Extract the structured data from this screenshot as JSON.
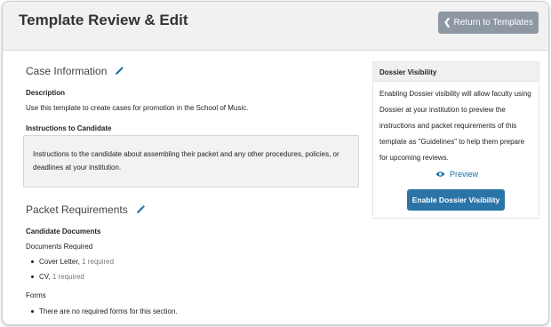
{
  "header": {
    "title": "Template Review & Edit",
    "return_label": "Return to Templates"
  },
  "case_info": {
    "title": "Case Information",
    "description_label": "Description",
    "description_text": "Use this template to create cases for promotion in the School of Music.",
    "instructions_label": "Instructions to Candidate",
    "instructions_text": "Instructions to the candidate about assembling their packet and any other procedures, policies, or deadlines at your institution."
  },
  "packet": {
    "title": "Packet Requirements",
    "candidate_docs_label": "Candidate Documents",
    "docs_required_label": "Documents Required",
    "documents": [
      {
        "name": "Cover Letter,",
        "requirement": "1 required"
      },
      {
        "name": "CV,",
        "requirement": "1 required"
      }
    ],
    "forms_label": "Forms",
    "forms_empty": "There are no required forms for this section."
  },
  "sidebar": {
    "title": "Dossier Visibility",
    "body": "Enabling Dossier visibility will allow faculty using Dossier at your institution to preview the instructions and packet requirements of this template as \"Guidelines\" to help them prepare for upcoming reviews.",
    "preview_label": "Preview",
    "enable_label": "Enable Dossier Visibility"
  },
  "colors": {
    "accent": "#2a74a8",
    "link": "#1a6ea3",
    "return_button": "#8e98a3"
  },
  "icons": {
    "edit": "pencil-icon",
    "back": "chevron-left-icon",
    "preview": "eye-icon"
  }
}
